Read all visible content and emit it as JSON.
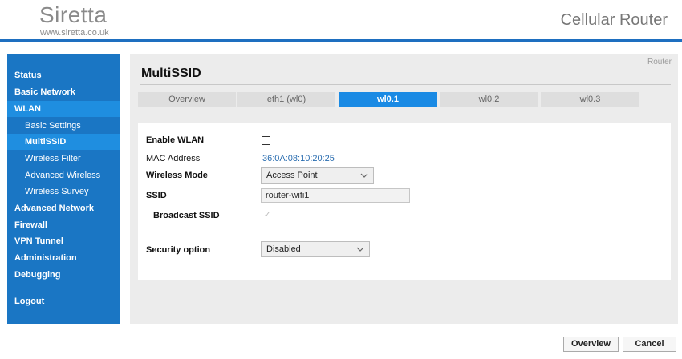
{
  "header": {
    "logo": "Siretta",
    "logo_url": "www.siretta.co.uk",
    "product": "Cellular Router"
  },
  "sidebar": {
    "items": [
      {
        "label": "Status"
      },
      {
        "label": "Basic Network"
      },
      {
        "label": "WLAN"
      },
      {
        "label": "Basic Settings"
      },
      {
        "label": "MultiSSID"
      },
      {
        "label": "Wireless Filter"
      },
      {
        "label": "Advanced Wireless"
      },
      {
        "label": "Wireless Survey"
      },
      {
        "label": "Advanced Network"
      },
      {
        "label": "Firewall"
      },
      {
        "label": "VPN Tunnel"
      },
      {
        "label": "Administration"
      },
      {
        "label": "Debugging"
      },
      {
        "label": "Logout"
      }
    ]
  },
  "main": {
    "breadcrumb": "Router",
    "title": "MultiSSID",
    "tabs": [
      {
        "label": "Overview"
      },
      {
        "label": "eth1 (wl0)"
      },
      {
        "label": "wl0.1"
      },
      {
        "label": "wl0.2"
      },
      {
        "label": "wl0.3"
      }
    ],
    "active_tab": "wl0.1",
    "form": {
      "enable_wlan_label": "Enable WLAN",
      "enable_wlan_checked": false,
      "mac_label": "MAC Address",
      "mac_value": "36:0A:08:10:20:25",
      "mode_label": "Wireless Mode",
      "mode_value": "Access Point",
      "ssid_label": "SSID",
      "ssid_value": "router-wifi1",
      "broadcast_label": "Broadcast SSID",
      "broadcast_checked": true,
      "security_label": "Security option",
      "security_value": "Disabled"
    }
  },
  "footer": {
    "overview_button": "Overview",
    "cancel_button": "Cancel"
  },
  "colors": {
    "brand_blue": "#1a76c4",
    "active_blue": "#1f8ee0",
    "tab_active": "#1a8ae4",
    "link_value": "#2a6db0"
  },
  "icons": {
    "select_arrow": "chevron-down-icon",
    "checkmark": "check-icon"
  }
}
